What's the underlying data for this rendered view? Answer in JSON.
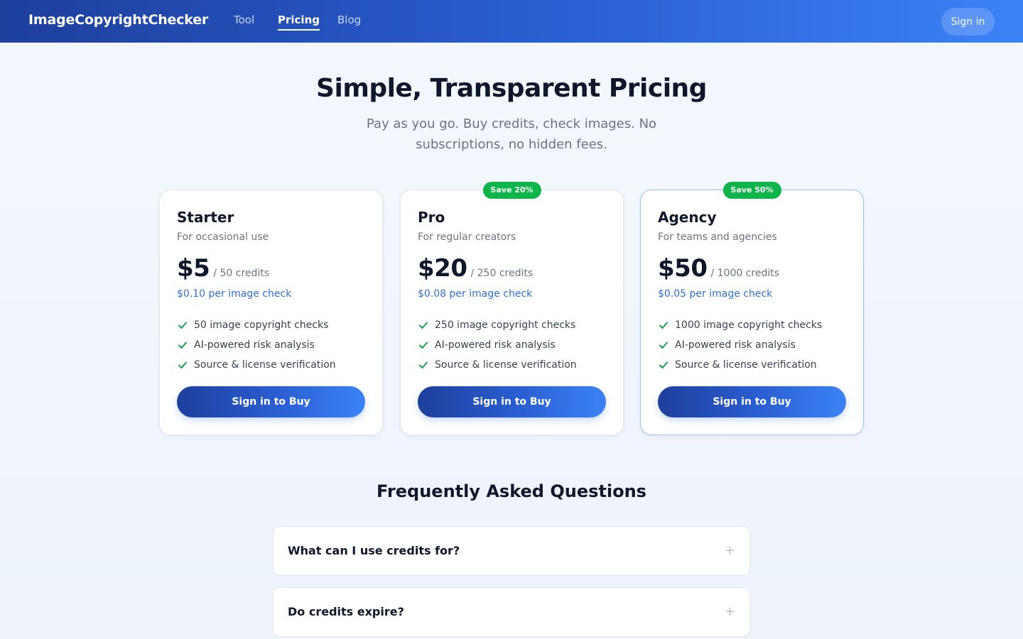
{
  "header": {
    "brand": "ImageCopyrightChecker",
    "nav": [
      {
        "label": "Tool",
        "active": false
      },
      {
        "label": "Pricing",
        "active": true
      },
      {
        "label": "Blog",
        "active": false
      }
    ],
    "signin_label": "Sign in"
  },
  "hero": {
    "title": "Simple, Transparent Pricing",
    "subtitle": "Pay as you go. Buy credits, check images. No subscriptions, no hidden fees."
  },
  "plans": [
    {
      "name": "Starter",
      "desc": "For occasional use",
      "price": "$5",
      "credits": "/ 50 credits",
      "per_check": "$0.10 per image check",
      "badge": "",
      "features": [
        "50 image copyright checks",
        "AI-powered risk analysis",
        "Source & license verification"
      ],
      "button": "Sign in to Buy"
    },
    {
      "name": "Pro",
      "desc": "For regular creators",
      "price": "$20",
      "credits": "/ 250 credits",
      "per_check": "$0.08 per image check",
      "badge": "Save 20%",
      "features": [
        "250 image copyright checks",
        "AI-powered risk analysis",
        "Source & license verification"
      ],
      "button": "Sign in to Buy"
    },
    {
      "name": "Agency",
      "desc": "For teams and agencies",
      "price": "$50",
      "credits": "/ 1000 credits",
      "per_check": "$0.05 per image check",
      "badge": "Save 50%",
      "features": [
        "1000 image copyright checks",
        "AI-powered risk analysis",
        "Source & license verification"
      ],
      "button": "Sign in to Buy"
    }
  ],
  "faq": {
    "title": "Frequently Asked Questions",
    "items": [
      {
        "q": "What can I use credits for?",
        "icon": "+"
      },
      {
        "q": "Do credits expire?",
        "icon": "+"
      }
    ]
  },
  "colors": {
    "accent": "#2a5fd3",
    "badge": "#0fb54b",
    "check": "#16a34a",
    "featured_border": "#93c5fd"
  }
}
